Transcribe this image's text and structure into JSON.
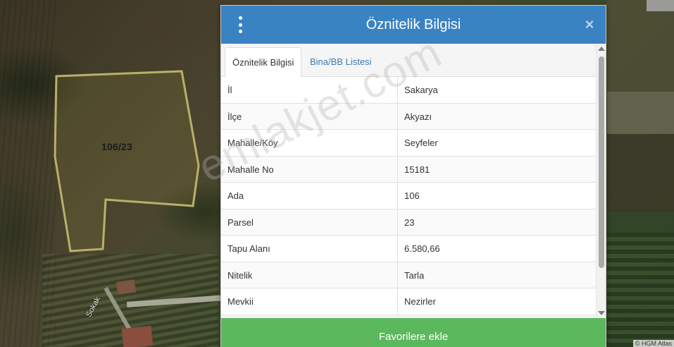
{
  "map": {
    "parcel_label": "106/23",
    "street_label": "Sokak",
    "attribution": "© HGM Atlas"
  },
  "modal": {
    "title": "Öznitelik Bilgisi",
    "close_label": "×",
    "tabs": [
      {
        "label": "Öznitelik Bilgisi",
        "active": true
      },
      {
        "label": "Bina/BB Listesi",
        "active": false
      }
    ],
    "rows": [
      {
        "key": "İl",
        "value": "Sakarya"
      },
      {
        "key": "İlçe",
        "value": "Akyazı"
      },
      {
        "key": "Mahalle/Köy",
        "value": "Seyfeler"
      },
      {
        "key": "Mahalle No",
        "value": "15181"
      },
      {
        "key": "Ada",
        "value": "106"
      },
      {
        "key": "Parsel",
        "value": "23"
      },
      {
        "key": "Tapu Alanı",
        "value": "6.580,66"
      },
      {
        "key": "Nitelik",
        "value": "Tarla"
      },
      {
        "key": "Mevkii",
        "value": "Nezirler"
      }
    ],
    "favorite_button": "Favorilere ekle"
  },
  "watermark": "emlakjet.com",
  "colors": {
    "header_blue": "#3a83c3",
    "tab_link_blue": "#3a7bb8",
    "button_green": "#5cb85c",
    "parcel_outline": "#b9b06a"
  }
}
